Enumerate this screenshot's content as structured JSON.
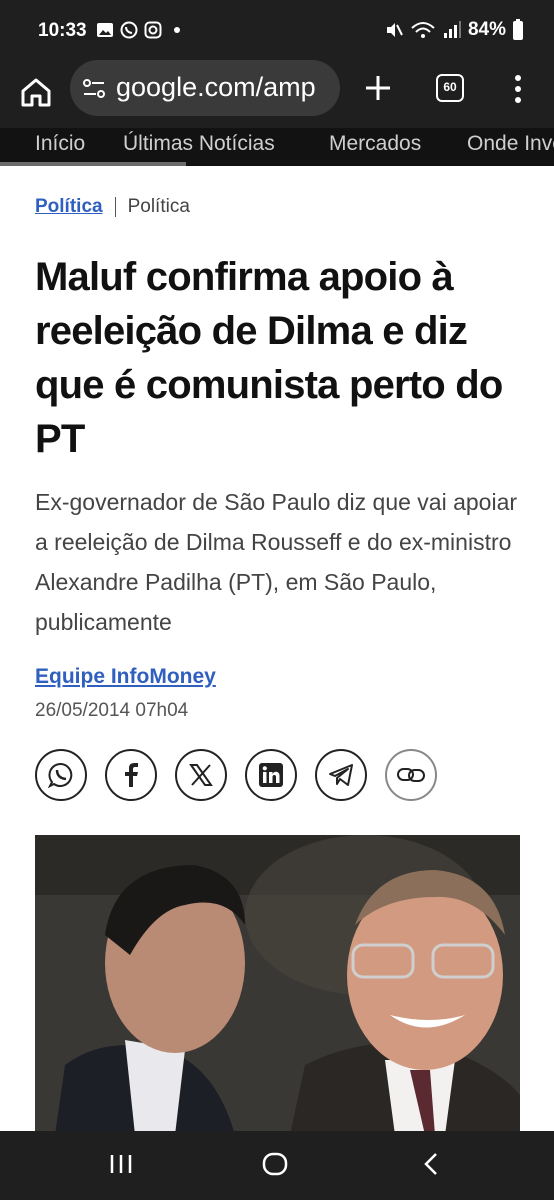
{
  "status_bar": {
    "time": "10:33",
    "battery": "84%",
    "icons_left": [
      "gallery-icon",
      "whatsapp-icon",
      "instagram-icon"
    ],
    "icons_right": [
      "mute-icon",
      "wifi-6e-icon",
      "signal-icon",
      "battery-icon"
    ]
  },
  "browser": {
    "url": "google.com/amp",
    "tab_count": "60"
  },
  "nav_tabs": [
    "Início",
    "Últimas Notícias",
    "Mercados",
    "Onde Investir"
  ],
  "article": {
    "category_link": "Política",
    "category_plain": "Política",
    "title": "Maluf confirma apoio à reeleição de Dilma e diz que é comunista perto do PT",
    "subtitle": "Ex-governador de São Paulo diz que vai apoiar a reeleição de Dilma Rousseff e do ex-ministro Alexandre Padilha (PT), em São Paulo, publicamente",
    "author": "Equipe InfoMoney",
    "date": "26/05/2014 07h04",
    "share_buttons": [
      "whatsapp-icon",
      "facebook-icon",
      "x-icon",
      "linkedin-icon",
      "telegram-icon",
      "link-icon"
    ]
  },
  "colors": {
    "link": "#2f5fbf",
    "chrome_bar": "#1f1f1f",
    "nav_bar": "#121212"
  }
}
